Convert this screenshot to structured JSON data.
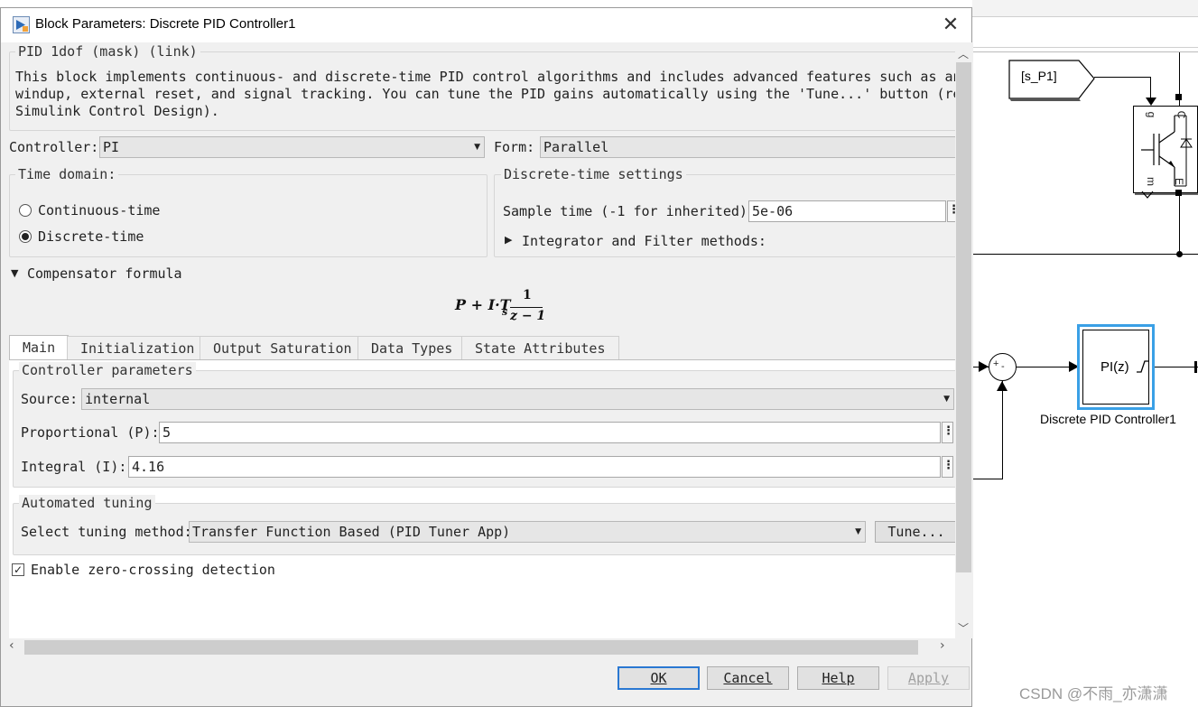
{
  "window": {
    "title": "Block Parameters: Discrete PID Controller1",
    "close_glyph": "✕"
  },
  "header": {
    "mask_label": "PID 1dof (mask) (link)",
    "description_lines": [
      "This block implements continuous- and discrete-time PID control algorithms and includes advanced features such as anti-",
      "windup, external reset, and signal tracking. You can tune the PID gains automatically using the 'Tune...' button (requires",
      "Simulink Control Design)."
    ]
  },
  "controller": {
    "label": "Controller:",
    "value": "PI"
  },
  "form": {
    "label": "Form:",
    "value": "Parallel"
  },
  "time_domain": {
    "legend": "Time domain:",
    "options": [
      {
        "label": "Continuous-time",
        "selected": false
      },
      {
        "label": "Discrete-time",
        "selected": true
      }
    ]
  },
  "discrete_settings": {
    "legend": "Discrete-time settings",
    "sample_time_label": "Sample time (-1 for inherited):",
    "sample_time_value": "5e-06",
    "integrator_methods_label": "Integrator and Filter methods:"
  },
  "compensator": {
    "label": "Compensator formula",
    "formula_main": "P + I·T",
    "formula_sub": "s",
    "numerator": "1",
    "denominator": "z − 1"
  },
  "tabs": [
    {
      "label": "Main",
      "active": true
    },
    {
      "label": "Initialization",
      "active": false
    },
    {
      "label": "Output Saturation",
      "active": false
    },
    {
      "label": "Data Types",
      "active": false
    },
    {
      "label": "State Attributes",
      "active": false
    }
  ],
  "controller_parameters": {
    "legend": "Controller parameters",
    "source_label": "Source:",
    "source_value": "internal",
    "proportional_label": "Proportional (P):",
    "proportional_value": "5",
    "integral_label": "Integral (I):",
    "integral_value": "4.16"
  },
  "automated_tuning": {
    "legend": "Automated tuning",
    "method_label": "Select tuning method:",
    "method_value": "Transfer Function Based (PID Tuner App)",
    "tune_button": "Tune..."
  },
  "zero_crossing": {
    "label": "Enable zero-crossing detection",
    "checked": true
  },
  "buttons": {
    "ok": "OK",
    "cancel": "Cancel",
    "help": "Help",
    "apply": "Apply"
  },
  "model": {
    "goto_tag": "[s_P1]",
    "pid_block_text": "PI(z)",
    "pid_block_name": "Discrete PID Controller1",
    "sum_sign_plus": "+",
    "sum_sign_minus": "-",
    "igbt_labels": {
      "g": "g",
      "c": "C",
      "m": "m",
      "e": "E"
    }
  },
  "watermark": "CSDN @不雨_亦潇潇",
  "colors": {
    "ok_focus": "#2a78d2",
    "selected_block": "#3aa0e6"
  }
}
